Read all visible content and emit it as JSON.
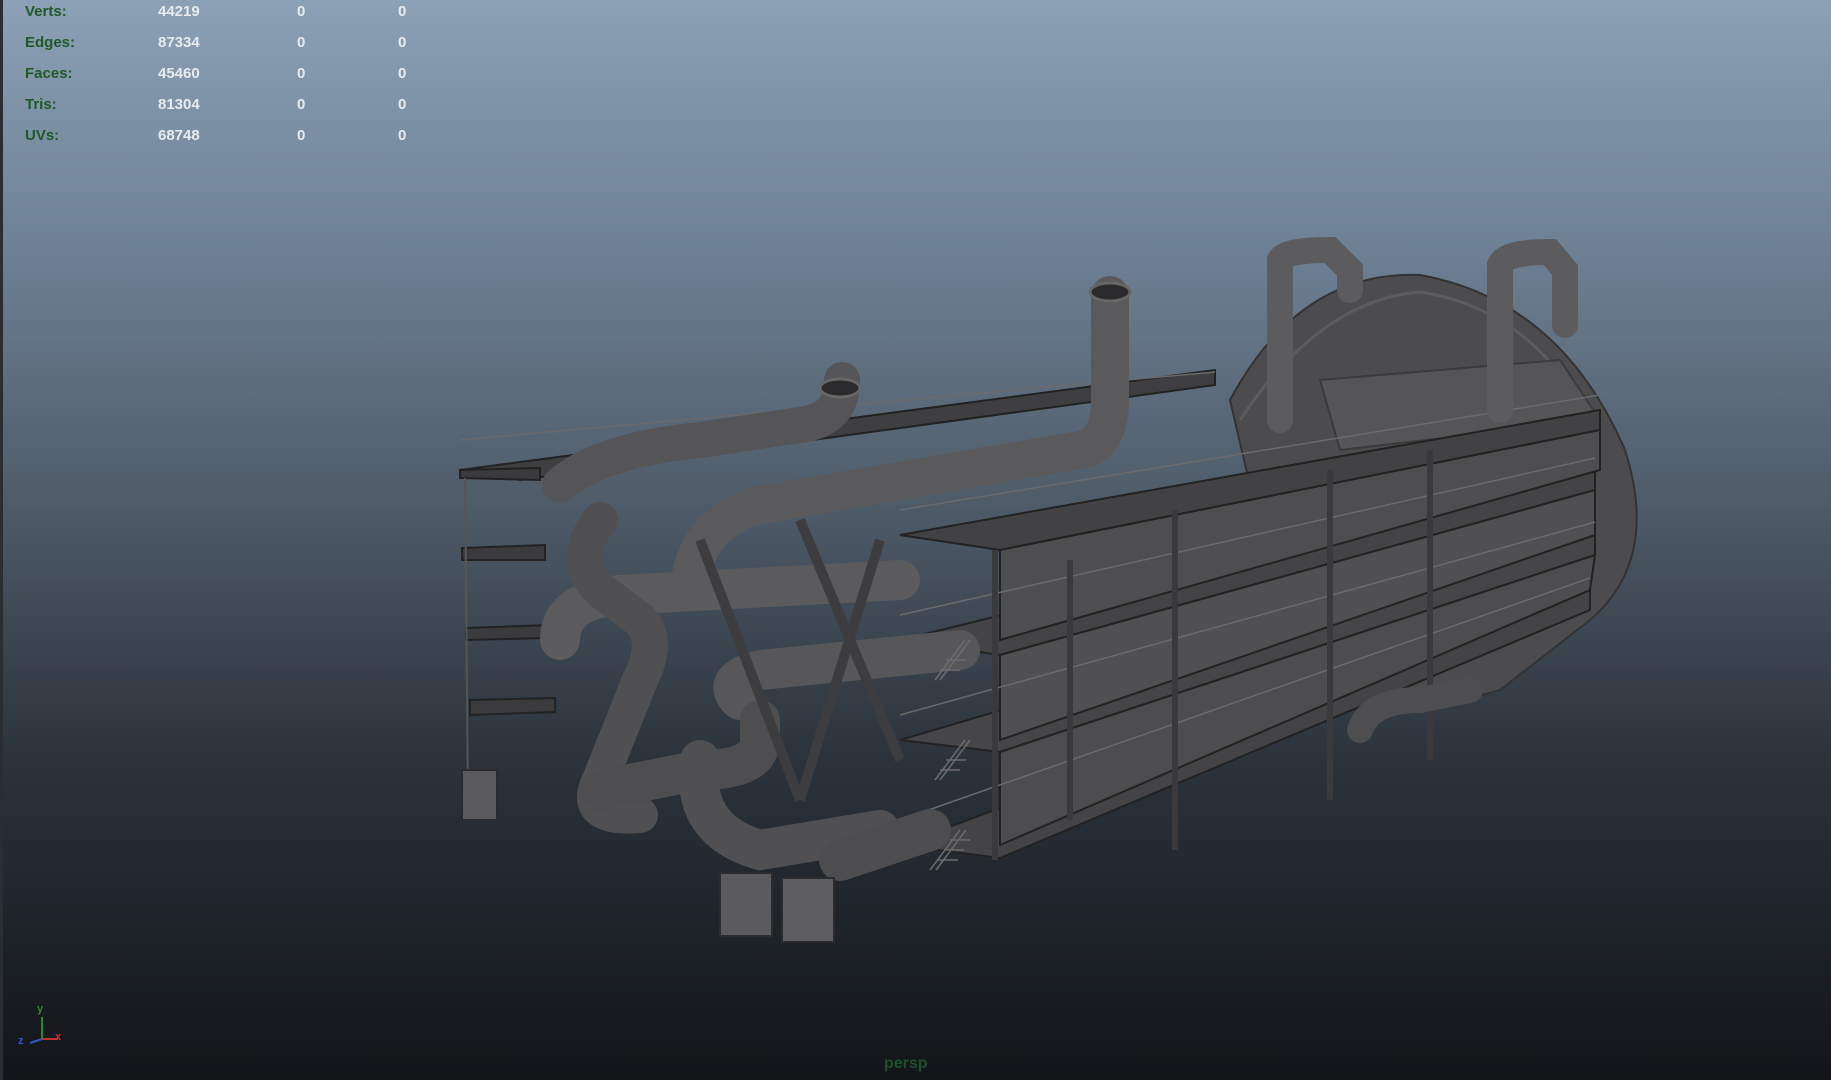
{
  "stats": [
    {
      "label": "Verts:",
      "total": "44219",
      "selected": "0",
      "extra": "0"
    },
    {
      "label": "Edges:",
      "total": "87334",
      "selected": "0",
      "extra": "0"
    },
    {
      "label": "Faces:",
      "total": "45460",
      "selected": "0",
      "extra": "0"
    },
    {
      "label": "Tris:",
      "total": "81304",
      "selected": "0",
      "extra": "0"
    },
    {
      "label": "UVs:",
      "total": "68748",
      "selected": "0",
      "extra": "0"
    }
  ],
  "axis": {
    "y": "y",
    "x": "x",
    "z": "z"
  },
  "camera": {
    "name": "persp"
  },
  "colors": {
    "hud_label": "#1f5a26",
    "hud_value": "#e8ecef",
    "model_gray": "#4a4a4c",
    "axis_x": "#c53030",
    "axis_y": "#2a8a2a",
    "axis_z": "#2d56c9"
  },
  "scene": {
    "object": "industrial-vessel-model"
  }
}
